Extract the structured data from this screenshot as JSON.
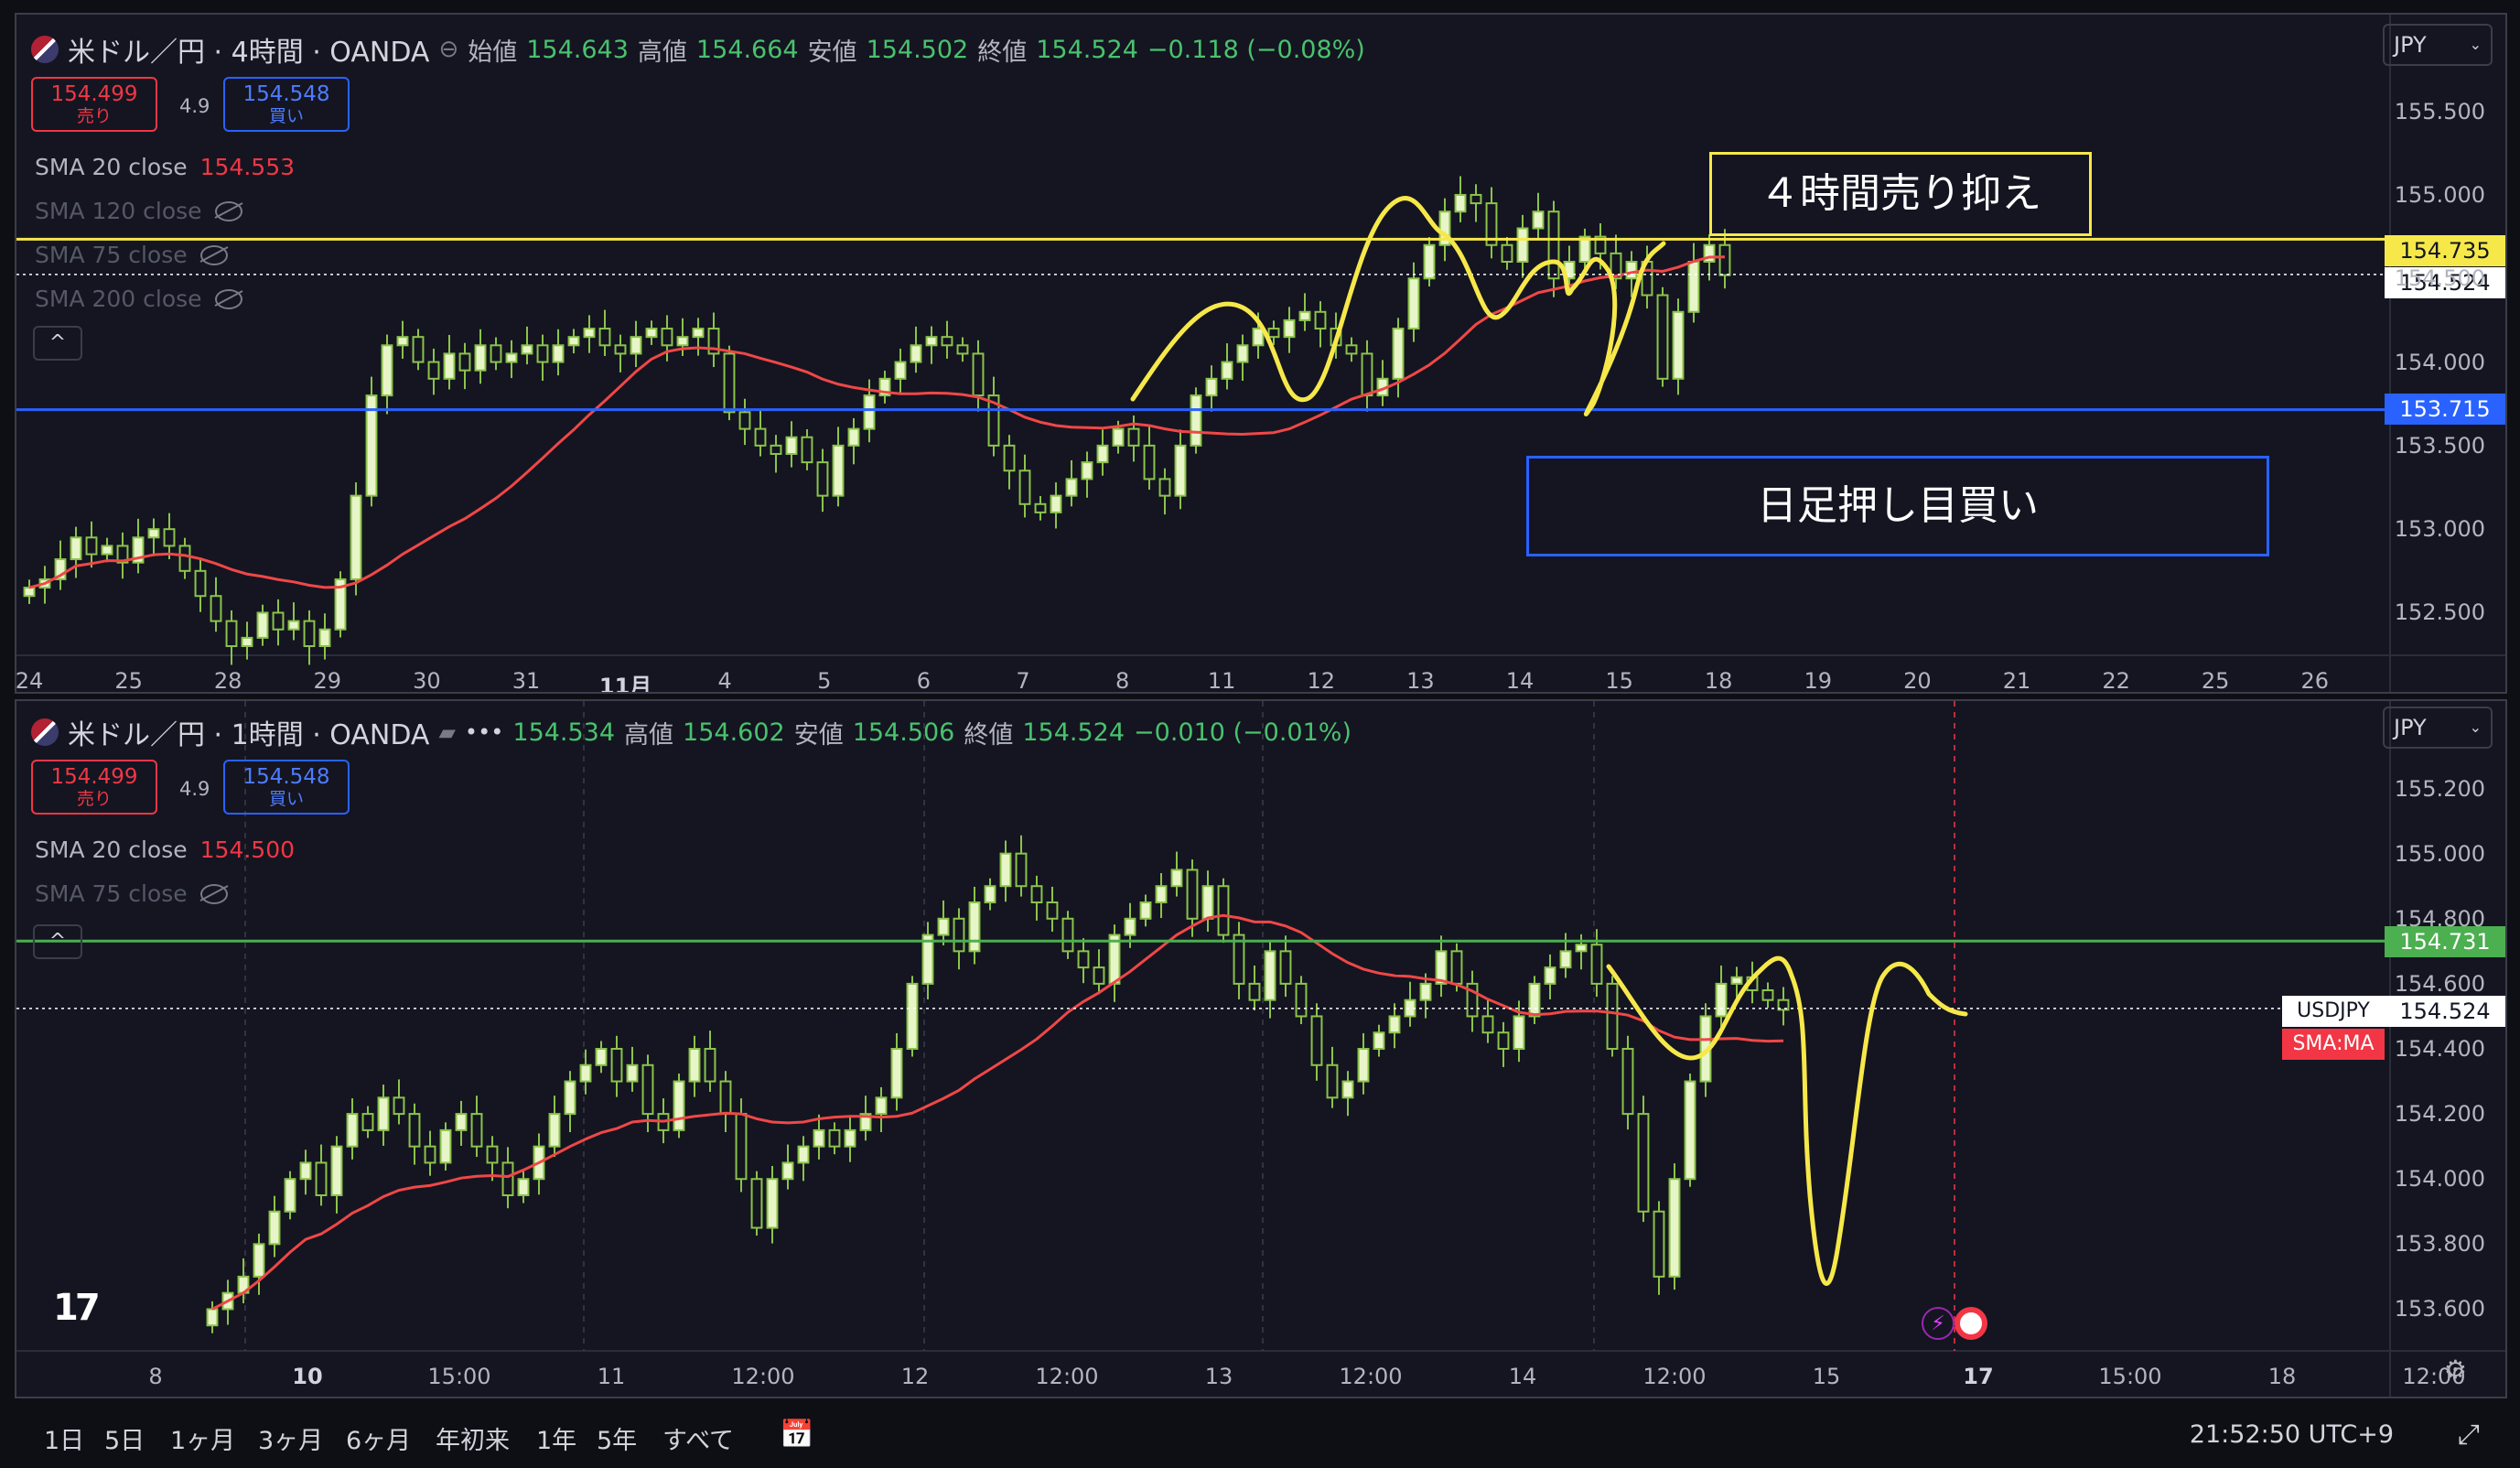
{
  "pane1": {
    "symbol": "米ドル／円 · 4時間 · OANDA",
    "ohlc": {
      "o_label": "始値",
      "o": "154.643",
      "h_label": "高値",
      "h": "154.664",
      "l_label": "安値",
      "l": "154.502",
      "c_label": "終値",
      "c": "154.524",
      "change": "−0.118 (−0.08%)"
    },
    "sell": {
      "price": "154.499",
      "label": "売り"
    },
    "buy": {
      "price": "154.548",
      "label": "買い"
    },
    "spread": "4.9",
    "sma": [
      {
        "name": "SMA 20 close",
        "value": "154.553"
      },
      {
        "name": "SMA 120 close",
        "value": ""
      },
      {
        "name": "SMA 75 close",
        "value": ""
      },
      {
        "name": "SMA 200 close",
        "value": ""
      }
    ],
    "currency": "JPY",
    "collapse": "^",
    "annotations": {
      "top": "４時間売り抑え",
      "bottom": "日足押し目買い"
    },
    "tags": {
      "resistance": "154.735",
      "last": "154.524",
      "support": "153.715"
    }
  },
  "pane2": {
    "symbol": "米ドル／円 · 1時間 · OANDA",
    "ohlc": {
      "o": "154.534",
      "h_label": "高値",
      "h": "154.602",
      "l_label": "安値",
      "l": "154.506",
      "c_label": "終値",
      "c": "154.524",
      "change": "−0.010 (−0.01%)"
    },
    "sell": {
      "price": "154.499",
      "label": "売り"
    },
    "buy": {
      "price": "154.548",
      "label": "買い"
    },
    "spread": "4.9",
    "sma": [
      {
        "name": "SMA 20 close",
        "value": "154.500"
      },
      {
        "name": "SMA 75 close",
        "value": ""
      }
    ],
    "currency": "JPY",
    "collapse": "^",
    "tags": {
      "level": "154.731",
      "symbol_label": "USDJPY",
      "last": "154.524",
      "sma_label": "SMA:MA"
    }
  },
  "chart_data": [
    {
      "type": "candlestick",
      "title": "米ドル／円 · 4時間 · OANDA",
      "ylim": [
        152.3,
        155.75
      ],
      "yticks": [
        152.5,
        153.0,
        153.5,
        154.0,
        154.5,
        155.0,
        155.5
      ],
      "ytick_labels": [
        "152.500",
        "153.000",
        "153.500",
        "154.000",
        "154.500",
        "155.000",
        "155.500"
      ],
      "x_ticks": [
        "24",
        "25",
        "28",
        "29",
        "30",
        "31",
        "11月",
        "4",
        "5",
        "6",
        "7",
        "8",
        "11",
        "12",
        "13",
        "14",
        "15",
        "18",
        "19",
        "20",
        "21",
        "22",
        "25",
        "26"
      ],
      "levels": [
        {
          "name": "resistance",
          "value": 154.735,
          "color": "#f7e84a"
        },
        {
          "name": "support",
          "value": 153.715,
          "color": "#2962ff"
        },
        {
          "name": "last",
          "value": 154.524,
          "color": "#ffffff"
        }
      ],
      "closes": [
        152.65,
        152.7,
        152.82,
        152.95,
        152.85,
        152.9,
        152.8,
        152.95,
        153.0,
        152.9,
        152.75,
        152.6,
        152.45,
        152.3,
        152.35,
        152.5,
        152.4,
        152.45,
        152.3,
        152.4,
        152.7,
        153.2,
        153.8,
        154.1,
        154.15,
        154.0,
        153.9,
        154.05,
        153.95,
        154.1,
        154.0,
        154.05,
        154.1,
        154.0,
        154.1,
        154.15,
        154.2,
        154.1,
        154.05,
        154.15,
        154.2,
        154.1,
        154.15,
        154.2,
        154.05,
        153.7,
        153.6,
        153.5,
        153.45,
        153.55,
        153.4,
        153.2,
        153.5,
        153.6,
        153.8,
        153.9,
        154.0,
        154.1,
        154.15,
        154.1,
        154.05,
        153.8,
        153.5,
        153.35,
        153.15,
        153.1,
        153.2,
        153.3,
        153.4,
        153.5,
        153.6,
        153.5,
        153.3,
        153.2,
        153.5,
        153.8,
        153.9,
        154.0,
        154.1,
        154.2,
        154.15,
        154.25,
        154.3,
        154.2,
        154.1,
        154.05,
        153.8,
        153.9,
        154.2,
        154.5,
        154.7,
        154.9,
        155.0,
        154.95,
        154.7,
        154.6,
        154.8,
        154.9,
        154.5,
        154.6,
        154.75,
        154.65,
        154.5,
        154.6,
        154.4,
        153.9,
        154.3,
        154.6,
        154.7,
        154.52
      ],
      "series": [
        {
          "name": "SMA 20 close",
          "color": "#f04747"
        }
      ]
    },
    {
      "type": "candlestick",
      "title": "米ドル／円 · 1時間 · OANDA",
      "ylim": [
        153.5,
        155.3
      ],
      "yticks": [
        153.6,
        153.8,
        154.0,
        154.2,
        154.4,
        154.6,
        154.8,
        155.0,
        155.2
      ],
      "ytick_labels": [
        "153.600",
        "153.800",
        "154.000",
        "154.200",
        "154.400",
        "154.600",
        "154.800",
        "155.000",
        "155.200"
      ],
      "x_ticks": [
        "8",
        "10",
        "15:00",
        "11",
        "12:00",
        "12",
        "12:00",
        "13",
        "12:00",
        "14",
        "12:00",
        "15",
        "17",
        "15:00",
        "18",
        "12:00"
      ],
      "levels": [
        {
          "name": "level",
          "value": 154.731,
          "color": "#4caf50"
        },
        {
          "name": "last",
          "value": 154.524,
          "color": "#ffffff"
        }
      ],
      "closes": [
        153.6,
        153.65,
        153.7,
        153.8,
        153.9,
        154.0,
        154.05,
        153.95,
        154.1,
        154.2,
        154.15,
        154.25,
        154.2,
        154.1,
        154.05,
        154.15,
        154.2,
        154.1,
        154.05,
        153.95,
        154.0,
        154.1,
        154.2,
        154.3,
        154.35,
        154.4,
        154.3,
        154.35,
        154.2,
        154.15,
        154.3,
        154.4,
        154.3,
        154.2,
        154.0,
        153.85,
        154.0,
        154.05,
        154.1,
        154.15,
        154.1,
        154.15,
        154.2,
        154.25,
        154.4,
        154.6,
        154.75,
        154.8,
        154.7,
        154.85,
        154.9,
        155.0,
        154.9,
        154.85,
        154.8,
        154.7,
        154.65,
        154.6,
        154.75,
        154.8,
        154.85,
        154.9,
        154.95,
        154.8,
        154.9,
        154.75,
        154.6,
        154.55,
        154.7,
        154.6,
        154.5,
        154.35,
        154.25,
        154.3,
        154.4,
        154.45,
        154.5,
        154.55,
        154.6,
        154.7,
        154.6,
        154.5,
        154.45,
        154.4,
        154.5,
        154.6,
        154.65,
        154.7,
        154.72,
        154.6,
        154.4,
        154.2,
        153.9,
        153.7,
        154.0,
        154.3,
        154.5,
        154.6,
        154.62,
        154.58,
        154.55,
        154.52
      ],
      "series": [
        {
          "name": "SMA 20 close",
          "color": "#f04747"
        }
      ]
    }
  ],
  "bottombar": {
    "ranges": [
      "1日",
      "5日",
      "1ヶ月",
      "3ヶ月",
      "6ヶ月",
      "年初来",
      "1年",
      "5年",
      "すべて"
    ],
    "clock": "21:52:50 UTC+9"
  }
}
